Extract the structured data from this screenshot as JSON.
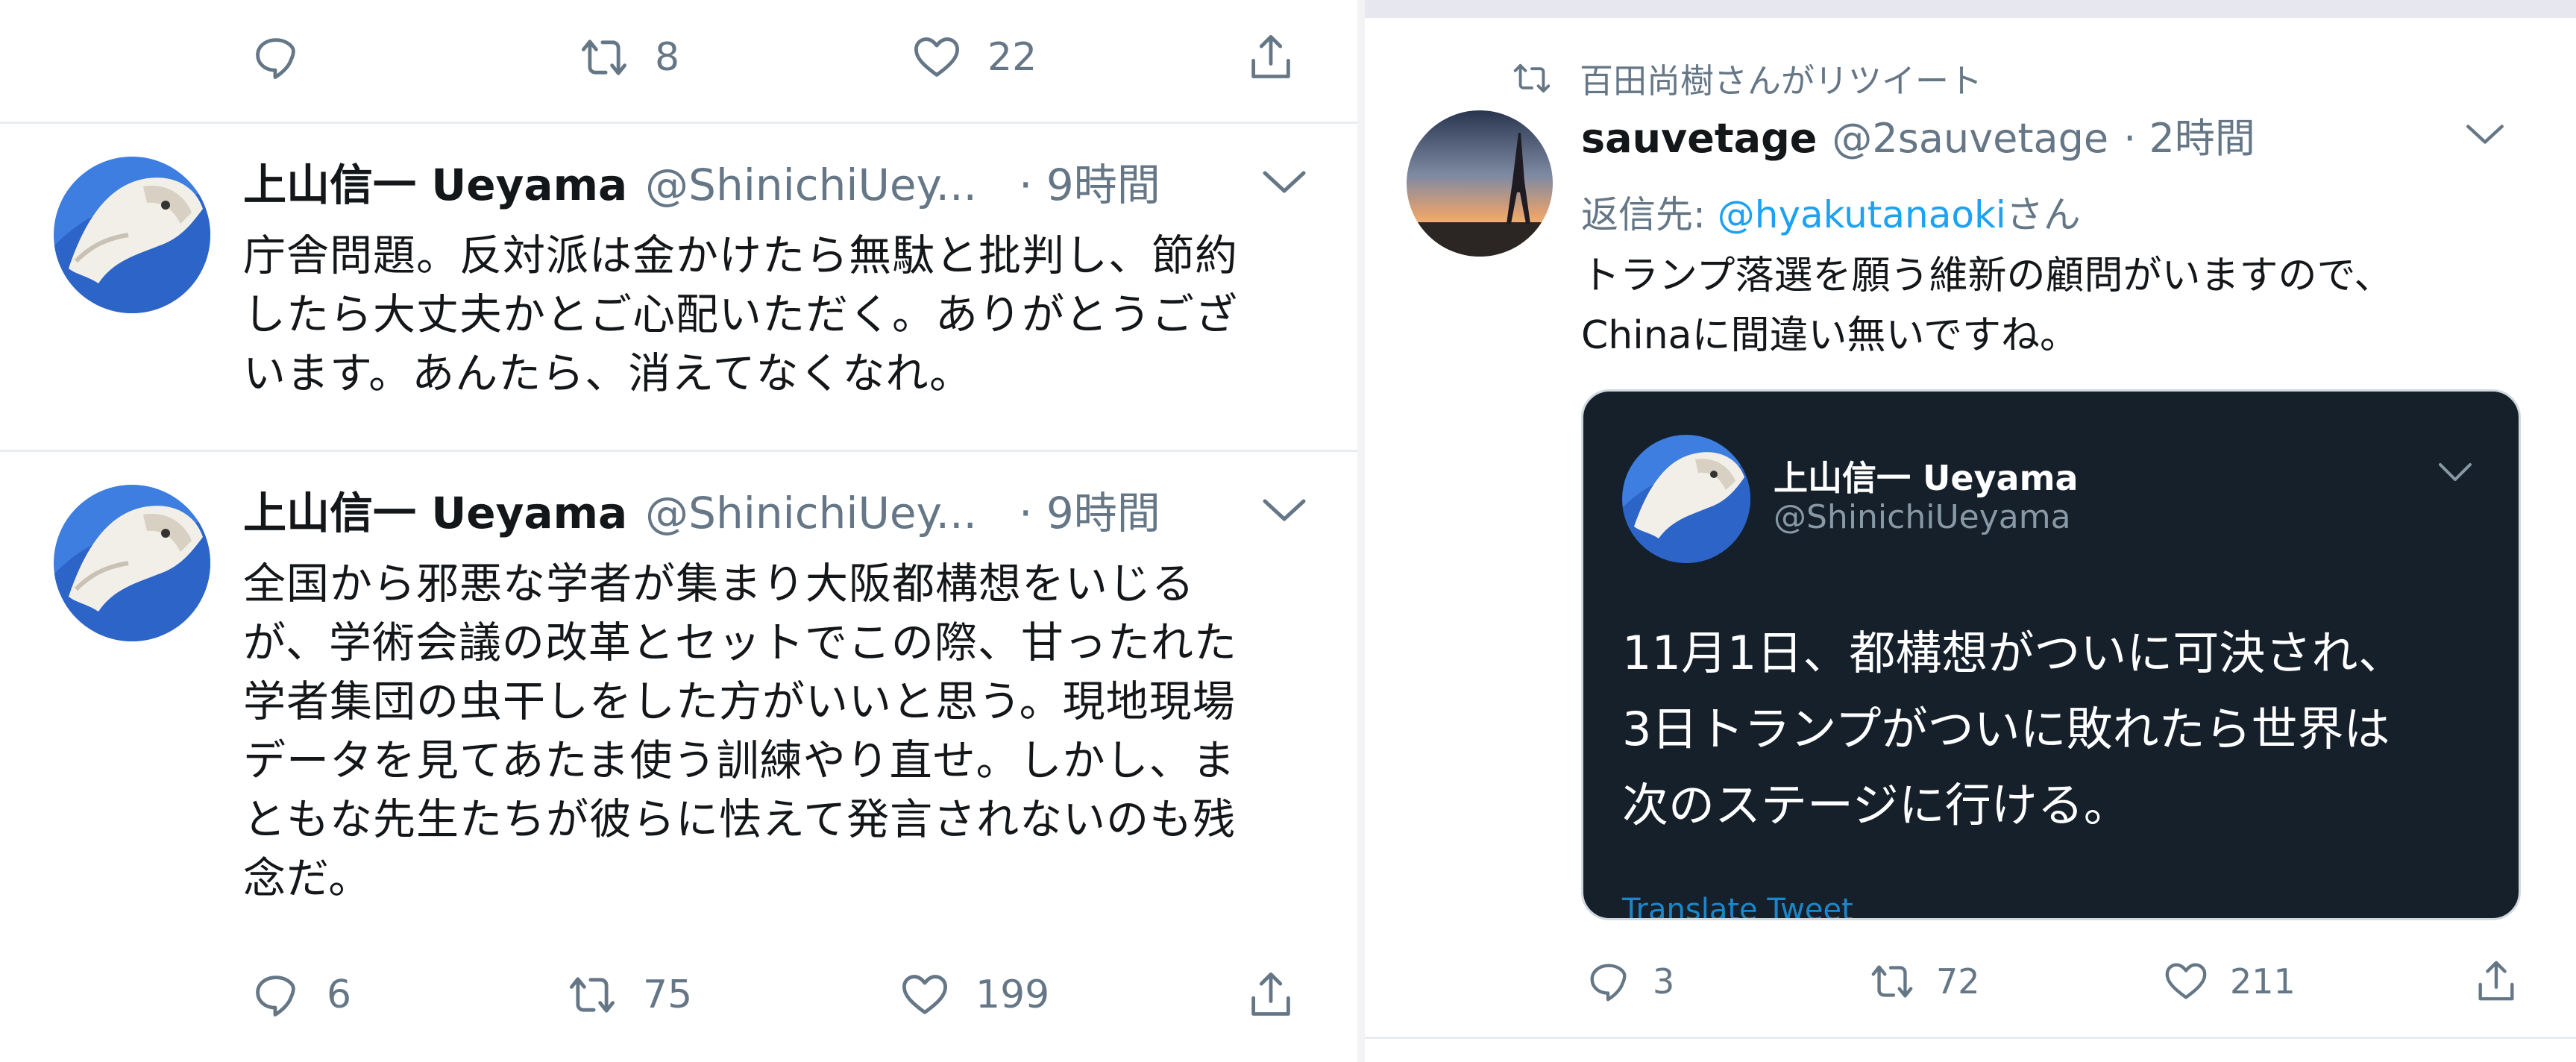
{
  "left": {
    "top_actions": {
      "reply": "",
      "retweets": "8",
      "likes": "22"
    },
    "tweets": [
      {
        "name": "上山信一 Ueyama",
        "handle": "@ShinichiUey...",
        "time": "· 9時間",
        "lines": [
          "庁舎問題。反対派は金かけたら無駄と批判し、節約",
          "したら大丈夫かとご心配いただく。ありがとうござ",
          "います。あんたら、消えてなくなれ。"
        ]
      },
      {
        "name": "上山信一 Ueyama",
        "handle": "@ShinichiUey...",
        "time": "· 9時間",
        "lines": [
          "全国から邪悪な学者が集まり大阪都構想をいじる",
          "が、学術会議の改革とセットでこの際、甘ったれた",
          "学者集団の虫干しをした方がいいと思う。現地現場",
          "データを見てあたま使う訓練やり直せ。しかし、ま",
          "ともな先生たちが彼らに怯えて発言されないのも残",
          "念だ。"
        ],
        "actions": {
          "replies": "6",
          "retweets": "75",
          "likes": "199"
        }
      }
    ]
  },
  "right": {
    "retweet_note": "百田尚樹さんがリツイート",
    "tweet": {
      "name": "sauvetage",
      "handle": "@2sauvetage",
      "time": "· 2時間",
      "reply_prefix": "返信先: ",
      "reply_mention": "@hyakutanaoki",
      "reply_suffix": "さん",
      "lines": [
        "トランプ落選を願う維新の顧問がいますので、",
        "Chinaに間違い無いですね。"
      ],
      "quote": {
        "name": "上山信一 Ueyama",
        "handle": "@ShinichiUeyama",
        "lines": [
          "11月1日、都構想がついに可決され、",
          "3日トランプがついに敗れたら世界は",
          "次のステージに行ける。"
        ],
        "translate": "Translate Tweet"
      },
      "actions": {
        "replies": "3",
        "retweets": "72",
        "likes": "211"
      }
    }
  },
  "colors": {
    "accent": "#1da1f2",
    "secondary_text": "#657786",
    "quote_bg": "#15202b",
    "divider": "#e6ecf0"
  },
  "icons": [
    "reply-icon",
    "retweet-icon",
    "like-icon",
    "share-icon",
    "chevron-down-icon"
  ]
}
